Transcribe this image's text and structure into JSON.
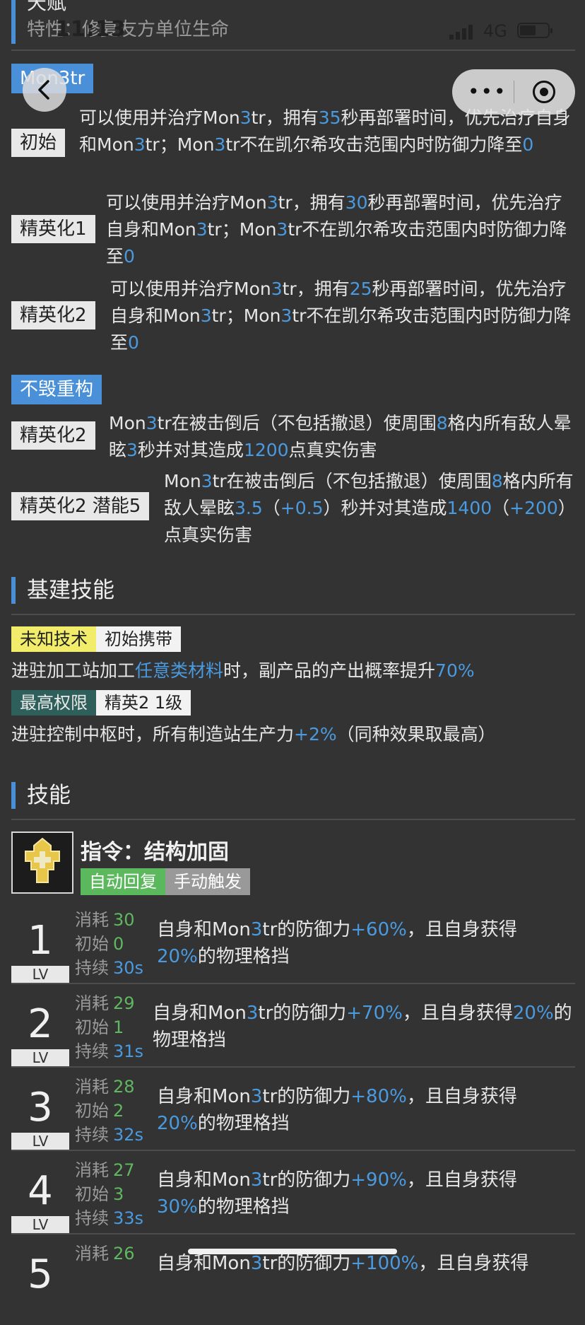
{
  "status_bar": {
    "time": "11:13",
    "network": "4G"
  },
  "talent_header": {
    "title": "天赋",
    "subtitle": "特性：修复友方单位生命"
  },
  "talent_mon3tr": {
    "name": "Mon3tr",
    "tiers": [
      {
        "badge": "初始",
        "text": "可以使用并治疗Mon3tr，拥有35秒再部署时间，优先治疗自身和Mon3tr；Mon3tr不在凯尔希攻击范围内时防御力降至0"
      },
      {
        "badge": "精英化1",
        "text": "可以使用并治疗Mon3tr，拥有30秒再部署时间，优先治疗自身和Mon3tr；Mon3tr不在凯尔希攻击范围内时防御力降至0"
      },
      {
        "badge": "精英化2",
        "text": "可以使用并治疗Mon3tr，拥有25秒再部署时间，优先治疗自身和Mon3tr；Mon3tr不在凯尔希攻击范围内时防御力降至0"
      }
    ]
  },
  "talent_rebuild": {
    "name": "不毁重构",
    "tiers": [
      {
        "badge": "精英化2",
        "text": "Mon3tr在被击倒后（不包括撤退）使周围8格内所有敌人晕眩3秒并对其造成1200点真实伤害"
      },
      {
        "badge": "精英化2 潜能5",
        "text": "Mon3tr在被击倒后（不包括撤退）使周围8格内所有敌人晕眩3.5（+0.5）秒并对其造成1400（+200）点真实伤害"
      }
    ]
  },
  "base_skills": {
    "title": "基建技能",
    "items": [
      {
        "name": "未知技术",
        "unlock": "初始携带",
        "desc": "进驻加工站加工任意类材料时，副产品的产出概率提升70%"
      },
      {
        "name": "最高权限",
        "unlock": "精英2 1级",
        "desc": "进驻控制中枢时，所有制造站生产力+2%（同种效果取最高）"
      }
    ]
  },
  "skills": {
    "title": "技能",
    "skill": {
      "name": "指令：结构加固",
      "icon": "shield-icon",
      "recovery": "自动回复",
      "trigger": "手动触发",
      "stat_labels": {
        "cost": "消耗",
        "initial": "初始",
        "duration": "持续"
      },
      "lv_label": "LV",
      "levels": [
        {
          "lv": "1",
          "cost": "30",
          "initial": "0",
          "duration": "30s",
          "desc": "自身和Mon3tr的防御力+60%，且自身获得20%的物理格挡"
        },
        {
          "lv": "2",
          "cost": "29",
          "initial": "1",
          "duration": "31s",
          "desc": "自身和Mon3tr的防御力+70%，且自身获得20%的物理格挡"
        },
        {
          "lv": "3",
          "cost": "28",
          "initial": "2",
          "duration": "32s",
          "desc": "自身和Mon3tr的防御力+80%，且自身获得20%的物理格挡"
        },
        {
          "lv": "4",
          "cost": "27",
          "initial": "3",
          "duration": "33s",
          "desc": "自身和Mon3tr的防御力+90%，且自身获得30%的物理格挡"
        },
        {
          "lv": "5",
          "cost": "26",
          "initial": "",
          "duration": "",
          "desc": "自身和Mon3tr的防御力+100%，且自身获得"
        }
      ]
    }
  },
  "colors": {
    "background": "#333333",
    "accent_blue": "#4a90d9",
    "highlight": "#4a9ae0",
    "green": "#5cb85c"
  }
}
